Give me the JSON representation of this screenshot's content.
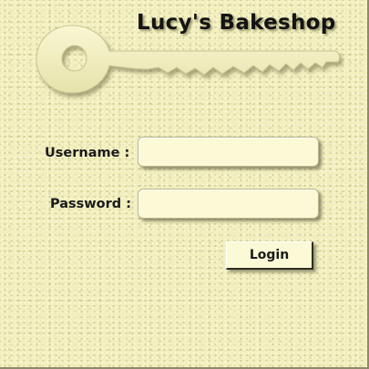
{
  "header": {
    "title": "Lucy's Bakeshop",
    "logo_icon": "key-icon"
  },
  "form": {
    "username_label": "Username :",
    "username_value": "",
    "password_label": "Password :",
    "password_value": "",
    "login_label": "Login"
  },
  "colors": {
    "background": "#f2efbd",
    "field_fill": "#fbf9d6",
    "text": "#1a1a1a"
  }
}
